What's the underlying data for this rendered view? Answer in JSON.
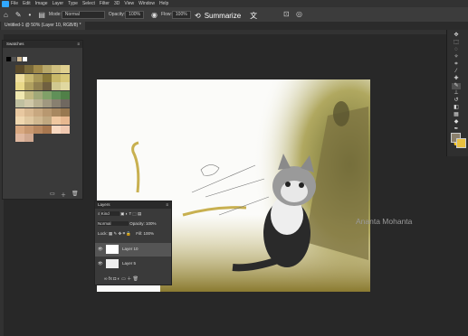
{
  "menu": {
    "items": [
      "File",
      "Edit",
      "Image",
      "Layer",
      "Type",
      "Select",
      "Filter",
      "3D",
      "View",
      "Window",
      "Help"
    ]
  },
  "options": {
    "mode_label": "Mode:",
    "mode_value": "Normal",
    "opacity_label": "Opacity:",
    "opacity_value": "100%",
    "flow_label": "Flow:",
    "flow_value": "100%"
  },
  "summarize": {
    "label": "Summarize"
  },
  "document": {
    "tab_title": "Untitled-1 @ 50% (Layer 10, RGB/8) *"
  },
  "swatches": {
    "title": "Swatches",
    "colors": [
      "#5a4a2a",
      "#7a6a3a",
      "#a08a4a",
      "#b8a86a",
      "#d0c080",
      "#e0d090",
      "#f0e0a0",
      "#c8b870",
      "#a89858",
      "#887838",
      "#c8b868",
      "#d8c878",
      "#e8d888",
      "#b0a060",
      "#908050",
      "#706040",
      "#d0c890",
      "#e0d8a0",
      "#f0e8b0",
      "#c0b880",
      "#a0a878",
      "#80a068",
      "#609058",
      "#508048",
      "#c0c0a0",
      "#d0c8a8",
      "#b8b090",
      "#a09880",
      "#888070",
      "#706860",
      "#e8c8a0",
      "#d8b890",
      "#c8a880",
      "#b89870",
      "#a88860",
      "#987850",
      "#f0d8b0",
      "#e0c8a0",
      "#d0b890",
      "#c0a880",
      "#f0c8a0",
      "#e8b890",
      "#d8a880",
      "#c89870",
      "#b88860",
      "#a87850",
      "#f8d8c0",
      "#f0c8b0",
      "#e0b8a0",
      "#d0a890"
    ]
  },
  "layers": {
    "title": "Layers",
    "kind": "Kind",
    "blend": "Normal",
    "opacity_label": "Opacity:",
    "opacity_value": "100%",
    "lock_label": "Lock:",
    "fill_label": "Fill:",
    "fill_value": "100%",
    "rows": [
      {
        "name": "Layer 10"
      },
      {
        "name": "Layer 5"
      }
    ]
  },
  "watermark": {
    "text": "Ananta Mohanta"
  },
  "colors": {
    "accent": "#31a8ff",
    "panel": "#3a3a3a"
  }
}
